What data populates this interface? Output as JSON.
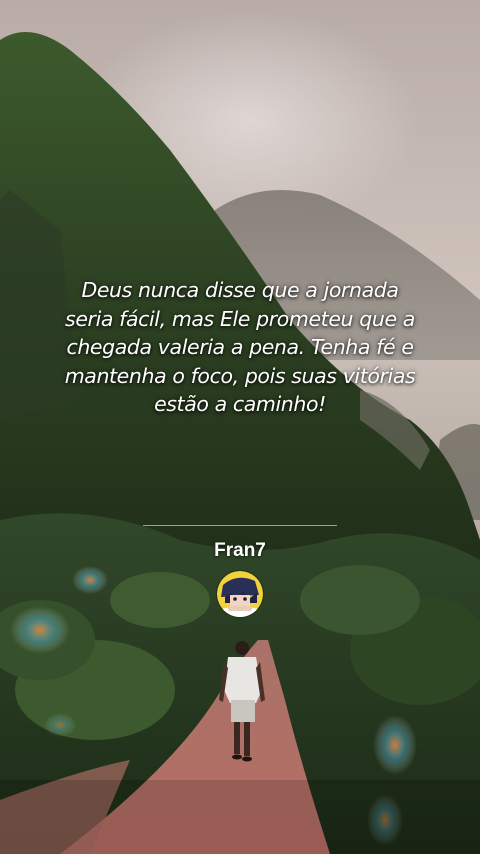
{
  "quote": {
    "line1": "Deus nunca disse que a jornada",
    "line2": "seria fácil, mas Ele prometeu que a",
    "line3": "chegada valeria a pena. Tenha fé e",
    "line4": "mantenha o foco, pois suas vitórias",
    "line5": "estão a caminho!"
  },
  "author": {
    "name": "Fran7",
    "avatar_icon": "anime-avatar-icon"
  }
}
